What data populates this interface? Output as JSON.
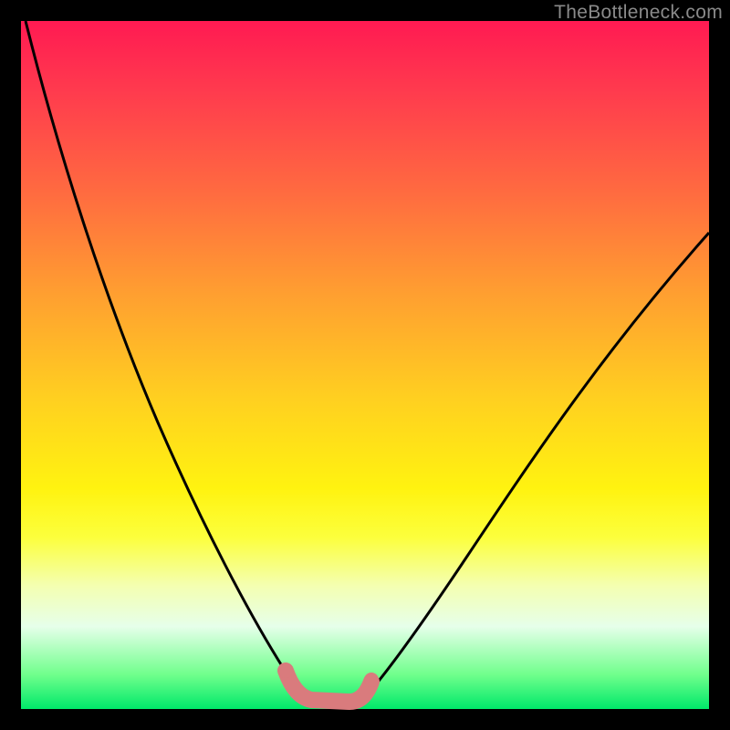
{
  "watermark": "TheBottleneck.com",
  "colors": {
    "black": "#000000",
    "pink_overlay": "#d97b7d",
    "gradient_top": "#ff1a52",
    "gradient_bottom": "#00e86a"
  },
  "chart_data": {
    "type": "line",
    "title": "",
    "xlabel": "",
    "ylabel": "",
    "legend": false,
    "xlim": [
      0,
      100
    ],
    "ylim": [
      0,
      100
    ],
    "series": [
      {
        "name": "left-descending-curve",
        "x": [
          0,
          5,
          10,
          15,
          20,
          25,
          30,
          35,
          37.5,
          40
        ],
        "values": [
          100,
          88,
          76,
          64,
          52,
          40,
          28,
          16,
          10,
          4
        ]
      },
      {
        "name": "right-ascending-curve",
        "x": [
          50,
          55,
          60,
          65,
          70,
          75,
          80,
          85,
          90,
          95,
          100
        ],
        "values": [
          4,
          9,
          15,
          22,
          29,
          36,
          43,
          50,
          57,
          63,
          69
        ]
      },
      {
        "name": "bottom-flat-overlay",
        "x": [
          37,
          40,
          45,
          48,
          50
        ],
        "values": [
          5,
          2,
          2,
          2,
          5
        ]
      }
    ],
    "notes": "Values read from visual position; chart has no axes or numeric labels. ylim top = image top, 0 = image bottom."
  }
}
